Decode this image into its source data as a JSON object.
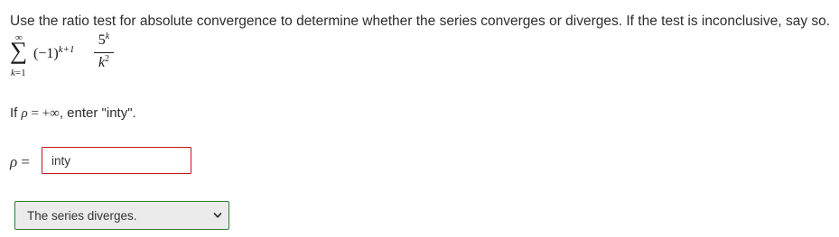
{
  "question": {
    "text": "Use the ratio test for absolute convergence to determine whether the series converges or diverges. If the test is inconclusive, say so."
  },
  "series": {
    "sum_upper": "∞",
    "sum_symbol": "∑",
    "sum_index_var": "k",
    "sum_index_eq": "=",
    "sum_index_start": "1",
    "sign_term": "(−1)",
    "sign_exponent": "k+1",
    "numerator_base": "5",
    "numerator_exponent": "k",
    "denominator_base": "k",
    "denominator_exponent": "2"
  },
  "infinity_note": {
    "prefix": "If ",
    "rho": "ρ",
    "equals": " = +",
    "infinity": "∞",
    "suffix": ", enter \"inty\"."
  },
  "rho_field": {
    "label_symbol": "ρ",
    "label_equals": " =",
    "value": "inty"
  },
  "conclusion_select": {
    "selected": "The series diverges.",
    "icon": "chevron-down-icon"
  },
  "colors": {
    "input_border_error": "#c4161c",
    "select_border_valid": "#2e7d32",
    "select_background": "#ebebeb"
  }
}
